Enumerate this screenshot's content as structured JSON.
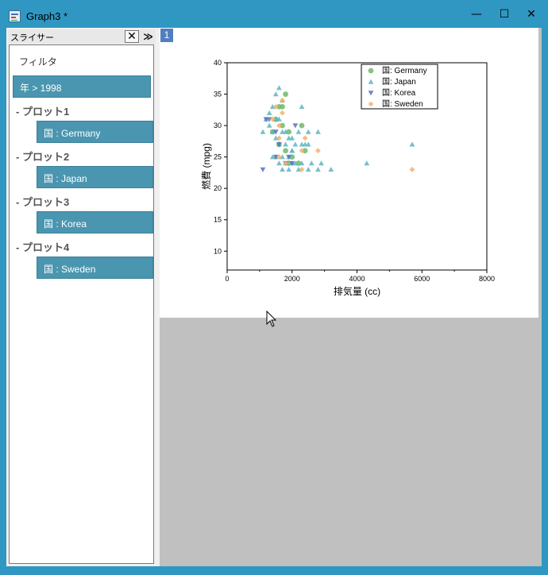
{
  "window": {
    "title": "Graph3 *"
  },
  "window_controls": {
    "minimize": "—",
    "maximize": "☐",
    "close": "✕"
  },
  "slicer": {
    "title": "スライサー",
    "close_symbol": "✕",
    "expand_symbol": "≫",
    "filter_label": "フィルタ",
    "filter_item": "年 > 1998",
    "plots": [
      {
        "header": "- プロット1",
        "item": "国 : Germany"
      },
      {
        "header": "- プロット2",
        "item": "国 : Japan"
      },
      {
        "header": "- プロット3",
        "item": "国 : Korea"
      },
      {
        "header": "- プロット4",
        "item": "国 : Sweden"
      }
    ]
  },
  "graph": {
    "layer_tab": "1"
  },
  "colors": {
    "Germany": "#6fb86b",
    "Japan": "#5eb5bf",
    "Korea": "#5b6fbf",
    "Sweden": "#f2b36b",
    "overlap": "#2f7a74"
  },
  "chart_data": {
    "type": "scatter",
    "xlabel": "排気量 (cc)",
    "ylabel": "燃費 (mpg)",
    "xlim": [
      0,
      8000
    ],
    "ylim": [
      7,
      40
    ],
    "xticks": [
      0,
      2000,
      4000,
      6000,
      8000
    ],
    "yticks": [
      10,
      15,
      20,
      25,
      30,
      35,
      40
    ],
    "legend_position": "top-right",
    "series": [
      {
        "name": "国: Germany",
        "marker": "circle",
        "color": "#6fb86b",
        "points": [
          [
            1800,
            35
          ],
          [
            1600,
            33
          ],
          [
            1700,
            33
          ],
          [
            1500,
            31
          ],
          [
            2300,
            30
          ],
          [
            1900,
            29
          ],
          [
            1600,
            27
          ],
          [
            1800,
            26
          ],
          [
            2000,
            25
          ],
          [
            2200,
            24
          ],
          [
            1900,
            24
          ],
          [
            2400,
            26
          ],
          [
            1400,
            29
          ],
          [
            1700,
            30
          ]
        ]
      },
      {
        "name": "国: Japan",
        "marker": "triangle-up",
        "color": "#5eb5bf",
        "points": [
          [
            1600,
            36
          ],
          [
            1500,
            35
          ],
          [
            1700,
            34
          ],
          [
            1400,
            33
          ],
          [
            2300,
            33
          ],
          [
            1300,
            32
          ],
          [
            1500,
            31
          ],
          [
            1600,
            31
          ],
          [
            1200,
            31
          ],
          [
            1100,
            29
          ],
          [
            1300,
            30
          ],
          [
            1400,
            29
          ],
          [
            1700,
            29
          ],
          [
            1800,
            29
          ],
          [
            1900,
            28
          ],
          [
            2000,
            28
          ],
          [
            2200,
            29
          ],
          [
            2500,
            29
          ],
          [
            2800,
            29
          ],
          [
            1500,
            28
          ],
          [
            1600,
            27
          ],
          [
            1800,
            27
          ],
          [
            2000,
            26
          ],
          [
            2100,
            27
          ],
          [
            2300,
            27
          ],
          [
            2400,
            27
          ],
          [
            2500,
            27
          ],
          [
            1400,
            25
          ],
          [
            1500,
            25
          ],
          [
            1700,
            25
          ],
          [
            1900,
            25
          ],
          [
            2000,
            24
          ],
          [
            2100,
            24
          ],
          [
            2300,
            24
          ],
          [
            1600,
            24
          ],
          [
            1800,
            24
          ],
          [
            1900,
            23
          ],
          [
            2200,
            23
          ],
          [
            2500,
            23
          ],
          [
            2900,
            24
          ],
          [
            3200,
            23
          ],
          [
            2800,
            23
          ],
          [
            4300,
            24
          ],
          [
            5700,
            27
          ],
          [
            1700,
            23
          ],
          [
            2000,
            26
          ],
          [
            2600,
            24
          ]
        ]
      },
      {
        "name": "国: Korea",
        "marker": "triangle-down",
        "color": "#5b6fbf",
        "points": [
          [
            1200,
            31
          ],
          [
            1300,
            31
          ],
          [
            2100,
            30
          ],
          [
            1600,
            27
          ],
          [
            1500,
            25
          ],
          [
            1900,
            25
          ],
          [
            1800,
            24
          ],
          [
            1100,
            23
          ],
          [
            2000,
            24
          ],
          [
            1500,
            29
          ]
        ]
      },
      {
        "name": "国: Sweden",
        "marker": "diamond",
        "color": "#f2b36b",
        "points": [
          [
            1700,
            34
          ],
          [
            1500,
            33
          ],
          [
            1700,
            32
          ],
          [
            1600,
            30
          ],
          [
            1600,
            28
          ],
          [
            2400,
            28
          ],
          [
            1600,
            25
          ],
          [
            2800,
            26
          ],
          [
            1800,
            24
          ],
          [
            2300,
            23
          ],
          [
            5700,
            23
          ],
          [
            2300,
            26
          ],
          [
            1400,
            31
          ]
        ]
      }
    ]
  }
}
